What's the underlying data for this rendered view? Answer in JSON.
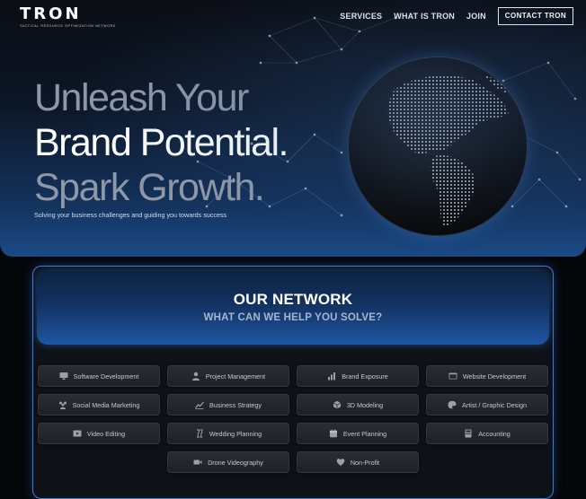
{
  "brand": {
    "name": "TRON",
    "tagline": "TACTICAL RESOURCE OPTIMIZATION NETWORK"
  },
  "nav": {
    "links": [
      "SERVICES",
      "WHAT IS TRON",
      "JOIN"
    ],
    "cta": "CONTACT TRON"
  },
  "hero": {
    "line1": "Unleash Your",
    "line2": "Brand Potential.",
    "line3": "Spark Growth.",
    "subtitle": "Solving your business challenges and guiding you towards success"
  },
  "network": {
    "title": "OUR NETWORK",
    "subtitle": "WHAT CAN WE HELP YOU SOLVE?"
  },
  "services": [
    {
      "label": "Software Development",
      "icon": "monitor-icon"
    },
    {
      "label": "Project Management",
      "icon": "person-icon"
    },
    {
      "label": "Brand Exposure",
      "icon": "bar-chart-icon"
    },
    {
      "label": "Website Development",
      "icon": "browser-window-icon"
    },
    {
      "label": "Social Media Marketing",
      "icon": "people-group-icon"
    },
    {
      "label": "Business Strategy",
      "icon": "trend-line-icon"
    },
    {
      "label": "3D Modeling",
      "icon": "cube-icon"
    },
    {
      "label": "Artist / Graphic Design",
      "icon": "palette-icon"
    },
    {
      "label": "Video Editing",
      "icon": "play-video-icon"
    },
    {
      "label": "Wedding Planning",
      "icon": "champagne-icon"
    },
    {
      "label": "Event Planning",
      "icon": "calendar-icon"
    },
    {
      "label": "Accounting",
      "icon": "calculator-icon"
    },
    {
      "label": "Drone Videography",
      "icon": "video-camera-icon"
    },
    {
      "label": "Non-Profit",
      "icon": "heart-icon"
    }
  ],
  "colors": {
    "accent_border": "#3a7de0",
    "hero_bottom": "#1b4a86",
    "card_bg": "#25282d"
  }
}
